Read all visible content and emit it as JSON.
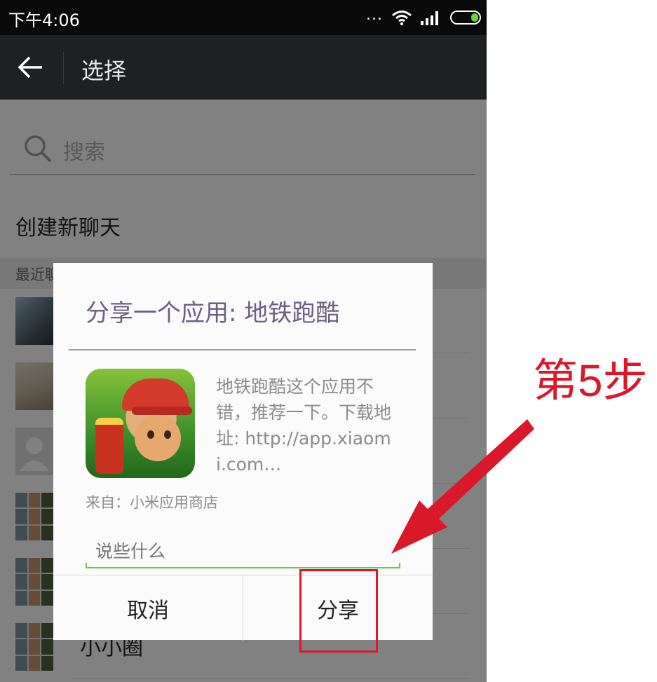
{
  "status_bar": {
    "time": "下午4:06",
    "dots": "..."
  },
  "action_bar": {
    "title": "选择"
  },
  "search": {
    "placeholder": "搜索"
  },
  "new_chat": "创建新聊天",
  "recent": {
    "header": "最近聊天"
  },
  "contacts": [
    {
      "name": ""
    },
    {
      "name": ""
    },
    {
      "name": ""
    },
    {
      "name": ""
    },
    {
      "name": ""
    },
    {
      "name": "小小圈"
    }
  ],
  "dialog": {
    "title": "分享一个应用: 地铁跑酷",
    "description": "地铁跑酷这个应用不错，推荐一下。下载地址: http://app.xiaomi.com…",
    "source": "来自：小米应用商店",
    "comment_placeholder": "说些什么",
    "cancel_label": "取消",
    "share_label": "分享"
  },
  "annotation": {
    "step_label": "第5步",
    "color": "#d9182a"
  },
  "colors": {
    "status_bar": "#0a0a0a",
    "action_bar": "#1f2022",
    "dialog_title": "#6b5f86",
    "input_underline": "#6ac94a"
  },
  "icons": [
    "back-arrow-icon",
    "search-icon",
    "wifi-icon",
    "signal-icon",
    "battery-icon",
    "app-icon-subway-surfers",
    "annotation-arrow"
  ]
}
